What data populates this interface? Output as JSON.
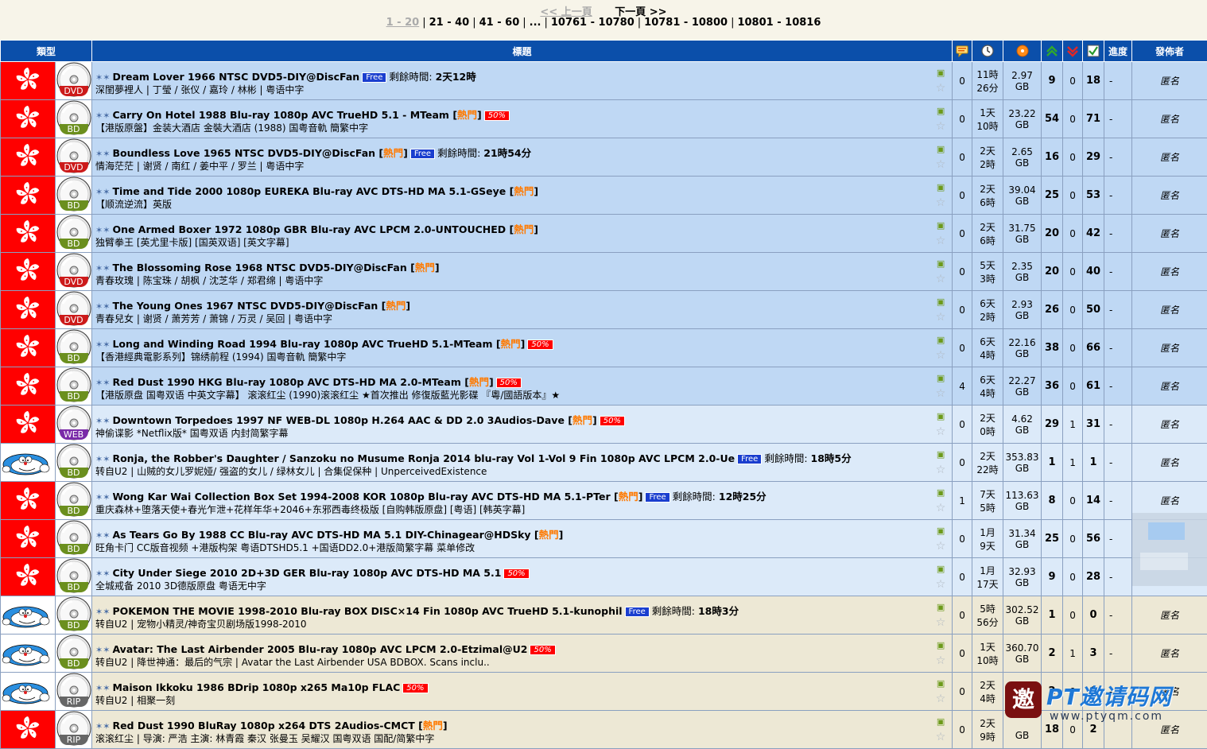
{
  "pager": {
    "prev": "<< 上一頁",
    "next": "下一頁 >>",
    "pages": [
      "1 - 20",
      "21 - 40",
      "41 - 60",
      "...",
      "10761 - 10780",
      "10781 - 10800",
      "10801 - 10816"
    ]
  },
  "header": {
    "type": "類型",
    "title": "標題",
    "progress": "進度",
    "uploader": "發佈者"
  },
  "rows": [
    {
      "style": "r-blue",
      "cat": "hk",
      "fmt": "DVD",
      "title": "Dream Lover 1966 NTSC DVD5-DIY@DiscFan",
      "hot": false,
      "free": true,
      "half": false,
      "remain_label": "剩餘時間:",
      "remain": "2天12時",
      "sub": "深閨夢裡人 | 丁瑩 / 张仪 / 嘉玲 / 林彬 | 粤语中字",
      "comments": "0",
      "time1": "11時",
      "time2": "26分",
      "size1": "2.97",
      "size2": "GB",
      "seed": "9",
      "leech": "0",
      "done": "18",
      "prog": "-",
      "uploader": "匿名"
    },
    {
      "style": "r-blue",
      "cat": "hk",
      "fmt": "BD",
      "title": "Carry On Hotel 1988 Blu-ray 1080p AVC TrueHD 5.1 - MTeam",
      "hot": true,
      "free": false,
      "half": true,
      "remain_label": "",
      "remain": "",
      "sub": "【港版原盤】金装大酒店 金裝大酒店 (1988) 国粤音軌 簡繁中字",
      "comments": "0",
      "time1": "1天",
      "time2": "10時",
      "size1": "23.22",
      "size2": "GB",
      "seed": "54",
      "leech": "0",
      "done": "71",
      "prog": "-",
      "uploader": "匿名"
    },
    {
      "style": "r-blue",
      "cat": "hk",
      "fmt": "DVD",
      "title": "Boundless Love 1965 NTSC DVD5-DIY@DiscFan",
      "hot": true,
      "free": true,
      "half": false,
      "remain_label": "剩餘時間:",
      "remain": "21時54分",
      "sub": "情海茫茫 | 谢贤 / 南红 / 姜中平 / 罗兰 | 粤语中字",
      "comments": "0",
      "time1": "2天",
      "time2": "2時",
      "size1": "2.65",
      "size2": "GB",
      "seed": "16",
      "leech": "0",
      "done": "29",
      "prog": "-",
      "uploader": "匿名"
    },
    {
      "style": "r-blue",
      "cat": "hk",
      "fmt": "BD",
      "title": "Time and Tide 2000 1080p EUREKA Blu-ray AVC DTS-HD MA 5.1-GSeye",
      "hot": true,
      "free": false,
      "half": false,
      "remain_label": "",
      "remain": "",
      "sub": "【顺流逆流】英版",
      "comments": "0",
      "time1": "2天",
      "time2": "6時",
      "size1": "39.04",
      "size2": "GB",
      "seed": "25",
      "leech": "0",
      "done": "53",
      "prog": "-",
      "uploader": "匿名"
    },
    {
      "style": "r-blue",
      "cat": "hk",
      "fmt": "BD",
      "title": "One Armed Boxer 1972 1080p GBR Blu-ray AVC LPCM 2.0-UNTOUCHED",
      "hot": true,
      "free": false,
      "half": false,
      "remain_label": "",
      "remain": "",
      "sub": "独臂拳王 [英尤里卡版] [国英双语] [英文字幕]",
      "comments": "0",
      "time1": "2天",
      "time2": "6時",
      "size1": "31.75",
      "size2": "GB",
      "seed": "20",
      "leech": "0",
      "done": "42",
      "prog": "-",
      "uploader": "匿名"
    },
    {
      "style": "r-blue",
      "cat": "hk",
      "fmt": "DVD",
      "title": "The Blossoming Rose 1968 NTSC DVD5-DIY@DiscFan",
      "hot": true,
      "free": false,
      "half": false,
      "remain_label": "",
      "remain": "",
      "sub": "青春玫瑰 | 陈宝珠 / 胡枫 / 沈芝华 / 郑君绵 | 粤语中字",
      "comments": "0",
      "time1": "5天",
      "time2": "3時",
      "size1": "2.35",
      "size2": "GB",
      "seed": "20",
      "leech": "0",
      "done": "40",
      "prog": "-",
      "uploader": "匿名"
    },
    {
      "style": "r-blue",
      "cat": "hk",
      "fmt": "DVD",
      "title": "The Young Ones 1967 NTSC DVD5-DIY@DiscFan",
      "hot": true,
      "free": false,
      "half": false,
      "remain_label": "",
      "remain": "",
      "sub": "青春兒女 | 谢贤 / 萧芳芳 / 萧锦 / 万灵 / 吴回 | 粤语中字",
      "comments": "0",
      "time1": "6天",
      "time2": "2時",
      "size1": "2.93",
      "size2": "GB",
      "seed": "26",
      "leech": "0",
      "done": "50",
      "prog": "-",
      "uploader": "匿名"
    },
    {
      "style": "r-blue",
      "cat": "hk",
      "fmt": "BD",
      "title": "Long and Winding Road 1994 Blu-ray 1080p AVC TrueHD 5.1-MTeam",
      "hot": true,
      "free": false,
      "half": true,
      "remain_label": "",
      "remain": "",
      "sub": "【香港經典電影系列】锦绣前程 (1994) 国粤音軌 簡繁中字",
      "comments": "0",
      "time1": "6天",
      "time2": "4時",
      "size1": "22.16",
      "size2": "GB",
      "seed": "38",
      "leech": "0",
      "done": "66",
      "prog": "-",
      "uploader": "匿名"
    },
    {
      "style": "r-blue",
      "cat": "hk",
      "fmt": "BD",
      "title": "Red Dust 1990 HKG Blu-ray 1080p AVC DTS-HD MA 2.0-MTeam",
      "hot": true,
      "free": false,
      "half": true,
      "remain_label": "",
      "remain": "",
      "sub": "【港版原盘 国粤双语 中英文字幕】 滚滚红尘 (1990)滚滚红尘 ★首次推出 修復版藍光影碟 『粵/國語版本』★",
      "comments": "4",
      "time1": "6天",
      "time2": "4時",
      "size1": "22.27",
      "size2": "GB",
      "seed": "36",
      "leech": "0",
      "done": "61",
      "prog": "-",
      "uploader": "匿名"
    },
    {
      "style": "r-light",
      "cat": "hk",
      "fmt": "WEB",
      "title": "Downtown Torpedoes 1997 NF WEB-DL 1080p H.264 AAC & DD 2.0 3Audios-Dave",
      "hot": true,
      "free": false,
      "half": true,
      "remain_label": "",
      "remain": "",
      "sub": "神偷谍影 *Netflix版* 国粤双语 内封简繁字幕",
      "comments": "0",
      "time1": "2天",
      "time2": "0時",
      "size1": "4.62",
      "size2": "GB",
      "seed": "29",
      "leech": "1",
      "done": "31",
      "prog": "-",
      "uploader": "匿名"
    },
    {
      "style": "r-light",
      "cat": "dora",
      "fmt": "BD",
      "title": "Ronja, the Robber's Daughter / Sanzoku no Musume Ronja 2014 blu-ray Vol 1-Vol 9 Fin 1080p AVC LPCM 2.0-Ue",
      "hot": false,
      "free": true,
      "half": false,
      "remain_label": "剩餘時間:",
      "remain": "18時5分",
      "sub": "转自U2 | 山贼的女儿罗妮娅/ 强盗的女儿 / 绿林女儿 | 合集促保种 | UnperceivedExistence",
      "comments": "0",
      "time1": "2天",
      "time2": "22時",
      "size1": "353.83",
      "size2": "GB",
      "seed": "1",
      "leech": "1",
      "done": "1",
      "prog": "-",
      "uploader": "匿名"
    },
    {
      "style": "r-light",
      "cat": "hk",
      "fmt": "BD",
      "title": "Wong Kar Wai Collection Box Set 1994-2008 KOR 1080p Blu-ray AVC DTS-HD MA 5.1-PTer",
      "hot": true,
      "free": true,
      "half": false,
      "remain_label": "剩餘時間:",
      "remain": "12時25分",
      "sub": "重庆森林+堕落天使+春光乍泄+花样年华+2046+东邪西毒终极版 [自购韩版原盘] [粤语] [韩英字幕]",
      "comments": "1",
      "time1": "7天",
      "time2": "5時",
      "size1": "113.63",
      "size2": "GB",
      "seed": "8",
      "leech": "0",
      "done": "14",
      "prog": "-",
      "uploader": "匿名"
    },
    {
      "style": "r-light",
      "cat": "hk",
      "fmt": "BD",
      "title": "As Tears Go By 1988 CC Blu-ray AVC DTS-HD MA 5.1 DIY-Chinagear@HDSky",
      "hot": true,
      "free": false,
      "half": false,
      "remain_label": "",
      "remain": "",
      "sub": "旺角卡门 CC版音视频 +港版构架 粤语DTSHD5.1 +国语DD2.0+港版简繁字幕 菜单修改",
      "comments": "0",
      "time1": "1月",
      "time2": "9天",
      "size1": "31.34",
      "size2": "GB",
      "seed": "25",
      "leech": "0",
      "done": "56",
      "prog": "-",
      "uploader": ""
    },
    {
      "style": "r-light",
      "cat": "hk",
      "fmt": "BD",
      "title": "City Under Siege 2010 2D+3D GER Blu-ray 1080p AVC DTS-HD MA 5.1",
      "hot": false,
      "free": false,
      "half": true,
      "remain_label": "",
      "remain": "",
      "sub": "全城戒备 2010 3D德版原盘 粤语无中字",
      "comments": "0",
      "time1": "1月",
      "time2": "17天",
      "size1": "32.93",
      "size2": "GB",
      "seed": "9",
      "leech": "0",
      "done": "28",
      "prog": "-",
      "uploader": ""
    },
    {
      "style": "r-beige",
      "cat": "dora",
      "fmt": "BD",
      "title": "POKEMON THE MOVIE 1998-2010 Blu-ray BOX DISC×14 Fin 1080p AVC TrueHD 5.1-kunophil",
      "hot": false,
      "free": true,
      "half": false,
      "remain_label": "剩餘時間:",
      "remain": "18時3分",
      "sub": "转自U2 | 宠物小精灵/神奇宝贝剧场版1998-2010",
      "comments": "0",
      "time1": "5時",
      "time2": "56分",
      "size1": "302.52",
      "size2": "GB",
      "seed": "1",
      "leech": "0",
      "done": "0",
      "prog": "-",
      "uploader": "匿名"
    },
    {
      "style": "r-beige",
      "cat": "dora",
      "fmt": "BD",
      "title": "Avatar: The Last Airbender 2005 Blu-ray 1080p AVC LPCM 2.0-Etzimal@U2",
      "hot": false,
      "free": false,
      "half": true,
      "remain_label": "",
      "remain": "",
      "sub": "转自U2 | 降世神通：最后的气宗 | Avatar the Last Airbender USA BDBOX. Scans inclu..",
      "comments": "0",
      "time1": "1天",
      "time2": "10時",
      "size1": "360.70",
      "size2": "GB",
      "seed": "2",
      "leech": "1",
      "done": "3",
      "prog": "-",
      "uploader": "匿名"
    },
    {
      "style": "r-beige",
      "cat": "dora",
      "fmt": "RIP",
      "title": "Maison Ikkoku 1986 BDrip 1080p x265 Ma10p FLAC",
      "hot": false,
      "free": false,
      "half": true,
      "remain_label": "",
      "remain": "",
      "sub": "转自U2 | 相聚一刻",
      "comments": "0",
      "time1": "2天",
      "time2": "4時",
      "size1": "73.31",
      "size2": "",
      "seed": "2",
      "leech": "0",
      "done": "6",
      "prog": "-",
      "uploader": "匿名"
    },
    {
      "style": "r-beige",
      "cat": "hk",
      "fmt": "RIP",
      "title": "Red Dust 1990 BluRay 1080p x264 DTS 2Audios-CMCT",
      "hot": true,
      "free": false,
      "half": false,
      "remain_label": "",
      "remain": "",
      "sub": "滚滚红尘 | 导演: 严浩 主演: 林青霞 秦汉 张曼玉 吴耀汉 国粤双语 国配/简繁中字",
      "comments": "0",
      "time1": "2天",
      "time2": "9時",
      "size1": "",
      "size2": "GB",
      "seed": "18",
      "leech": "0",
      "done": "2",
      "prog": "",
      "uploader": "匿名"
    }
  ],
  "labels": {
    "free": "Free",
    "half": "50%",
    "hot": "熱門"
  },
  "watermark": {
    "seal": "邀",
    "title": "PT邀请码网",
    "url": "www.ptyqm.com"
  },
  "colors": {
    "header_bg": "#0b4faa",
    "row_blue": "#bfd8f4",
    "row_light": "#dceaf9",
    "row_beige": "#ede8d5",
    "hot": "#ff7a00",
    "free_badge": "#1a3ecf",
    "half_badge": "#ff0000",
    "dvd_tag": "#cc1a1a",
    "bd_tag": "#6b8f1e",
    "web_tag": "#7a2aa8",
    "rip_tag": "#666666"
  }
}
